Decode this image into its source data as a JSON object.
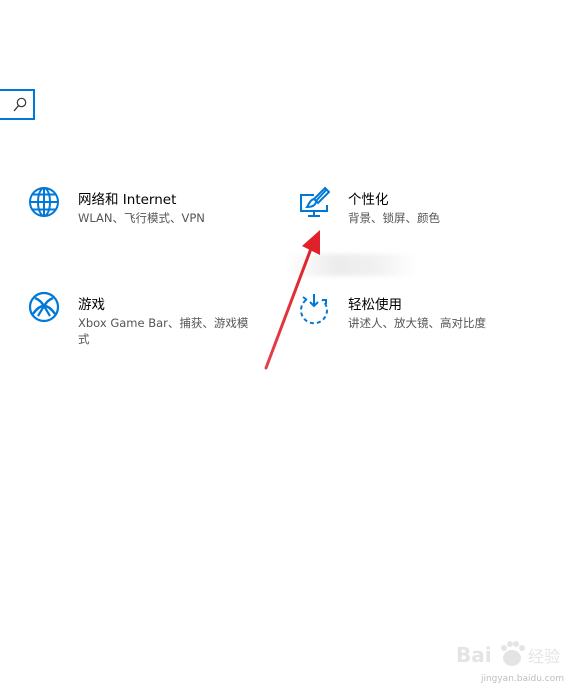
{
  "tiles": [
    {
      "title": "网络和 Internet",
      "desc": "WLAN、飞行模式、VPN",
      "icon": "globe-icon"
    },
    {
      "title": "个性化",
      "desc": "背景、锁屏、颜色",
      "icon": "paintbrush-monitor-icon"
    },
    {
      "title": "游戏",
      "desc": "Xbox Game Bar、捕获、游戏模式",
      "icon": "xbox-icon"
    },
    {
      "title": "轻松使用",
      "desc": "讲述人、放大镜、高对比度",
      "icon": "ease-of-access-icon"
    }
  ],
  "watermark": {
    "url": "jingyan.baidu.com"
  },
  "colors": {
    "accent": "#0078d7",
    "arrow": "#e0202a"
  }
}
